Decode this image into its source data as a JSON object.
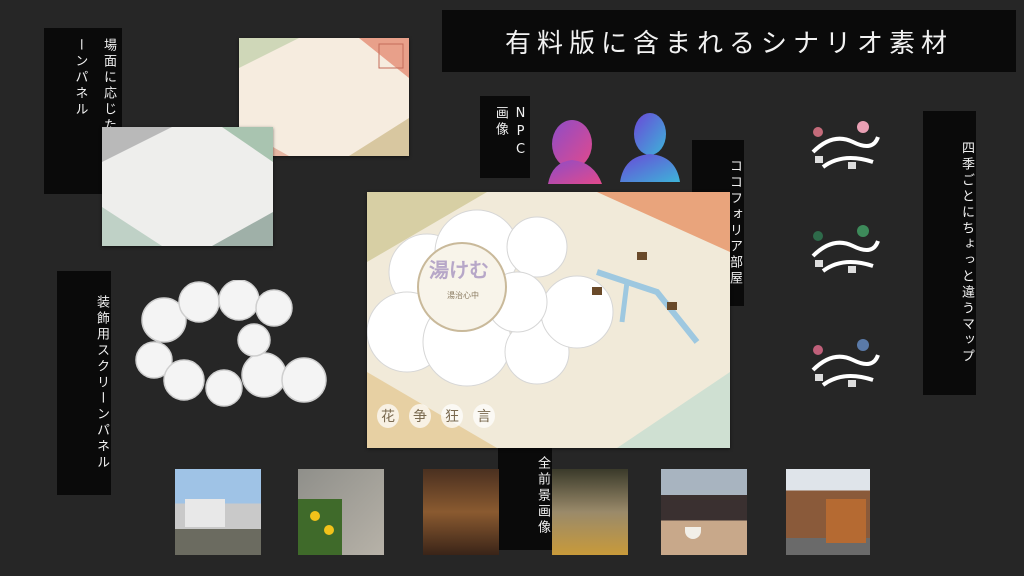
{
  "header": {
    "title": "有料版に含まれるシナリオ素材"
  },
  "labels": {
    "scene_panel": "場面に応じたスクリーンパネル",
    "npc": "NPC画像",
    "cocoforia_room": "ココフォリア部屋",
    "seasonal_map": "四季ごとにちょっと違うマップ",
    "deco_panel": "装飾用スクリーンパネル",
    "foreground": "全前景画像"
  },
  "main_board": {
    "logo_text": "湯けむ",
    "sub_text": "湯治心中",
    "bottom_text": [
      "花",
      "争",
      "狂",
      "言"
    ]
  },
  "colors": {
    "background": "#262626",
    "label_bg": "#0a0a0a",
    "label_text": "#f2f2f2"
  }
}
